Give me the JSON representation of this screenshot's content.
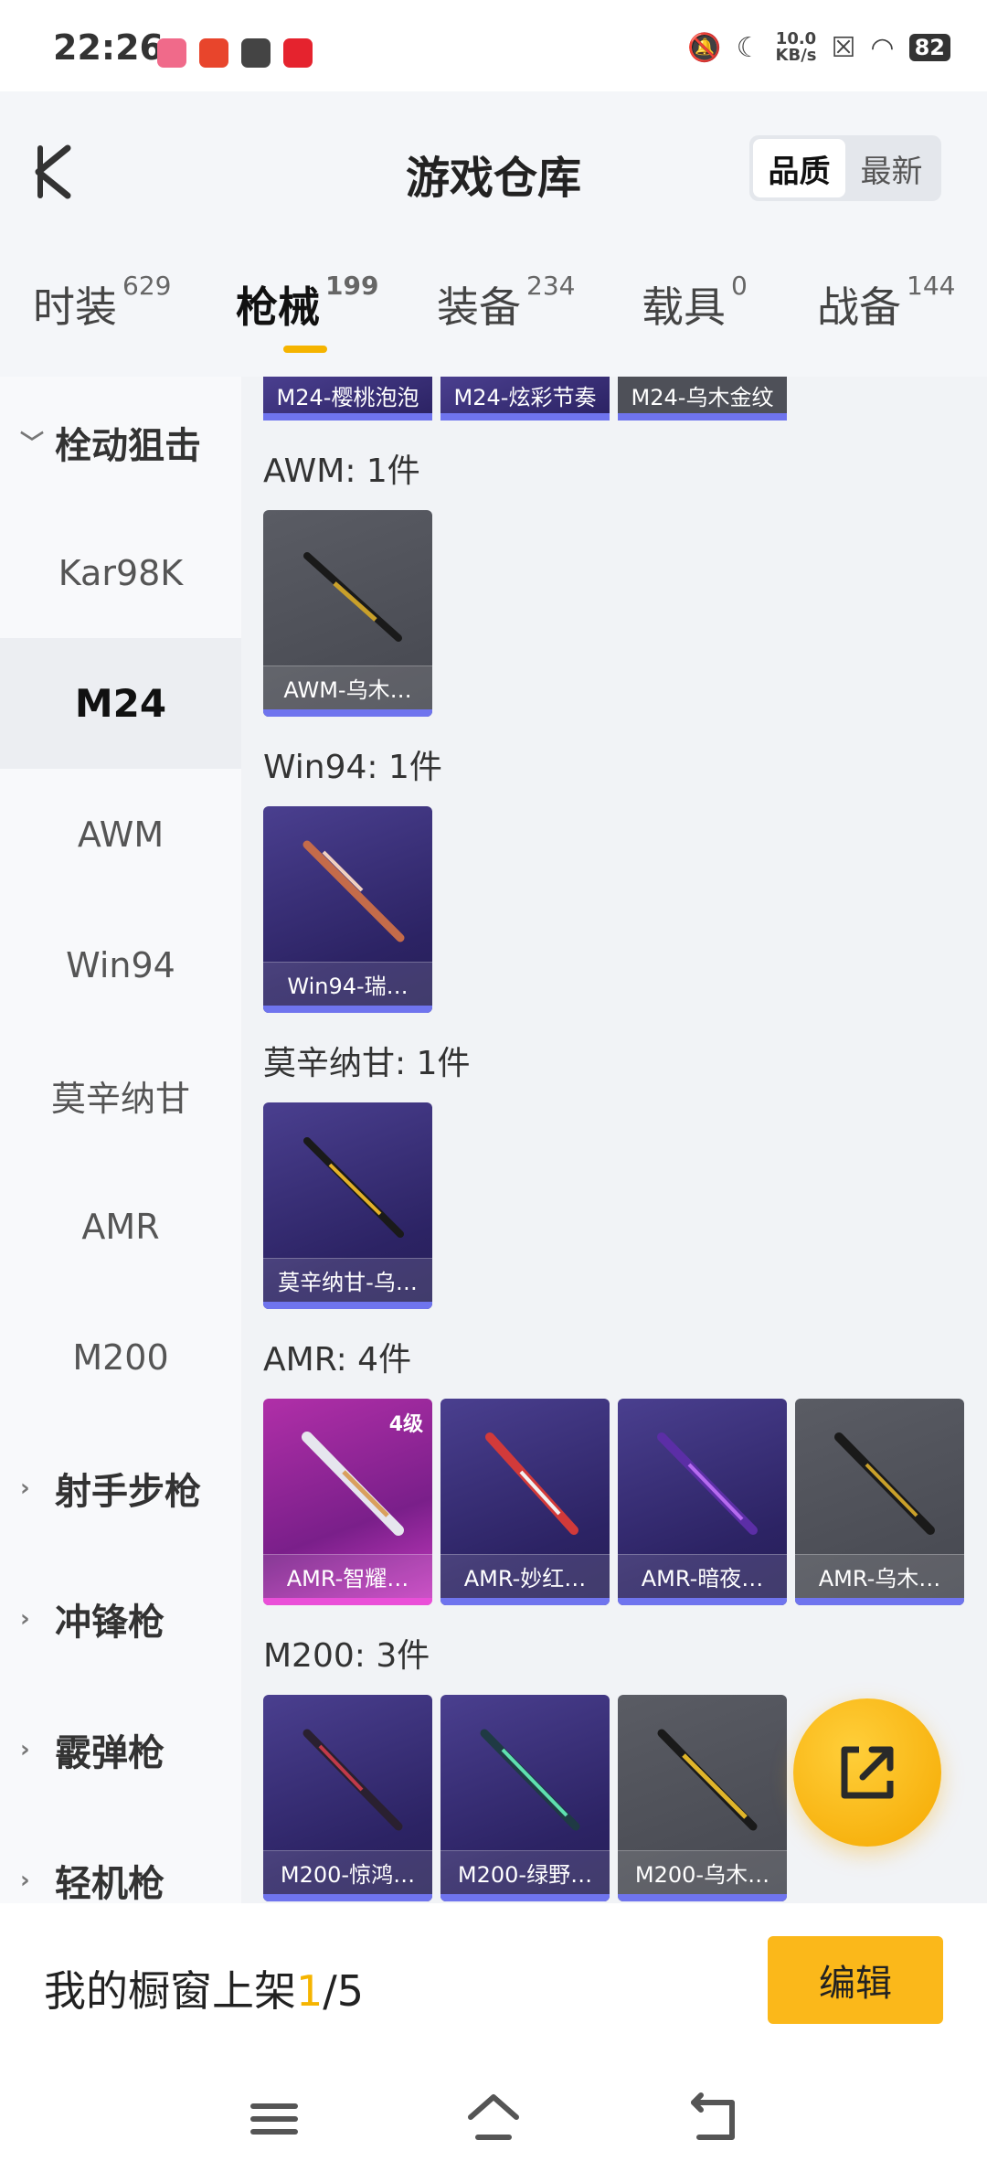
{
  "status_bar": {
    "time": "22:26",
    "net_speed_top": "10.0",
    "net_speed_bottom": "KB/s",
    "battery": "82"
  },
  "header": {
    "title": "游戏仓库",
    "sort_options": [
      "品质",
      "最新"
    ],
    "sort_active": "品质"
  },
  "tabs": [
    {
      "label": "时装",
      "count": "629"
    },
    {
      "label": "枪械",
      "count": "199"
    },
    {
      "label": "装备",
      "count": "234"
    },
    {
      "label": "载具",
      "count": "0"
    },
    {
      "label": "战备",
      "count": "144"
    }
  ],
  "active_tab": "枪械",
  "sidebar": {
    "group_open": "栓动狙击",
    "items": [
      "Kar98K",
      "M24",
      "AWM",
      "Win94",
      "莫辛纳甘",
      "AMR",
      "M200"
    ],
    "active_item": "M24",
    "groups": [
      "射手步枪",
      "冲锋枪",
      "霰弹枪",
      "轻机枪"
    ]
  },
  "content": {
    "partial_row": [
      "M24-樱桃泡泡",
      "M24-炫彩节奏",
      "M24-乌木金纹"
    ],
    "sections": [
      {
        "title": "AWM: 1件",
        "items": [
          {
            "name": "AWM-乌木…",
            "style": "grey"
          }
        ]
      },
      {
        "title": "Win94: 1件",
        "items": [
          {
            "name": "Win94-瑞…",
            "style": "purple"
          }
        ]
      },
      {
        "title": "莫辛纳甘: 1件",
        "items": [
          {
            "name": "莫辛纳甘-乌…",
            "style": "purple"
          }
        ]
      },
      {
        "title": "AMR: 4件",
        "items": [
          {
            "name": "AMR-智耀…",
            "style": "pink",
            "level": "4级"
          },
          {
            "name": "AMR-妙红…",
            "style": "purple"
          },
          {
            "name": "AMR-暗夜…",
            "style": "purple"
          },
          {
            "name": "AMR-乌木…",
            "style": "grey"
          }
        ]
      },
      {
        "title": "M200: 3件",
        "items": [
          {
            "name": "M200-惊鸿…",
            "style": "purple"
          },
          {
            "name": "M200-绿野…",
            "style": "purple"
          },
          {
            "name": "M200-乌木…",
            "style": "grey"
          }
        ]
      }
    ]
  },
  "bottom": {
    "showcase_prefix": "我的橱窗上架",
    "showcase_current": "1",
    "showcase_total": "/5",
    "edit_label": "编辑"
  }
}
